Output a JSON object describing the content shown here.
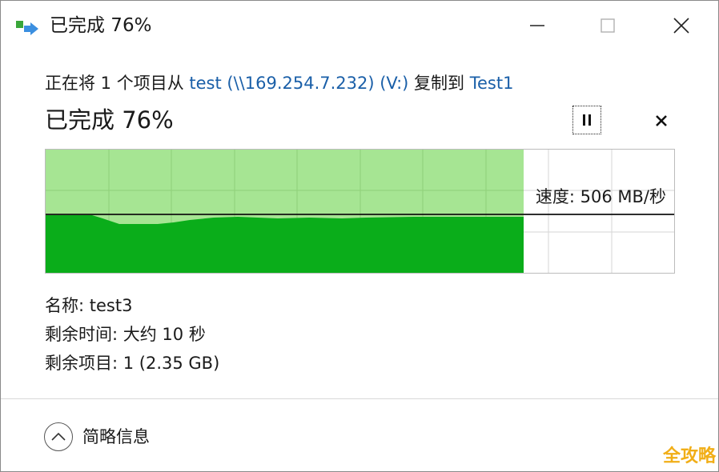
{
  "window": {
    "title": "已完成 76%",
    "icon": "copy-arrow-icon"
  },
  "copy_info": {
    "prefix": "正在将 1 个项目从 ",
    "source": "test (\\\\169.254.7.232) (V:)",
    "middle": " 复制到 ",
    "destination": "Test1"
  },
  "progress": {
    "label": "已完成 76%",
    "percent": 76
  },
  "speed": {
    "label": "速度: 506 MB/秒"
  },
  "details": {
    "name": "名称: test3",
    "time_remaining": "剩余时间: 大约 10 秒",
    "items_remaining": "剩余项目: 1 (2.35 GB)"
  },
  "footer": {
    "toggle_label": "简略信息"
  },
  "watermark": {
    "text": "全攻略"
  },
  "colors": {
    "fill_dark": "#0aad1a",
    "fill_light": "#a6e593",
    "link": "#1a5fa8"
  }
}
